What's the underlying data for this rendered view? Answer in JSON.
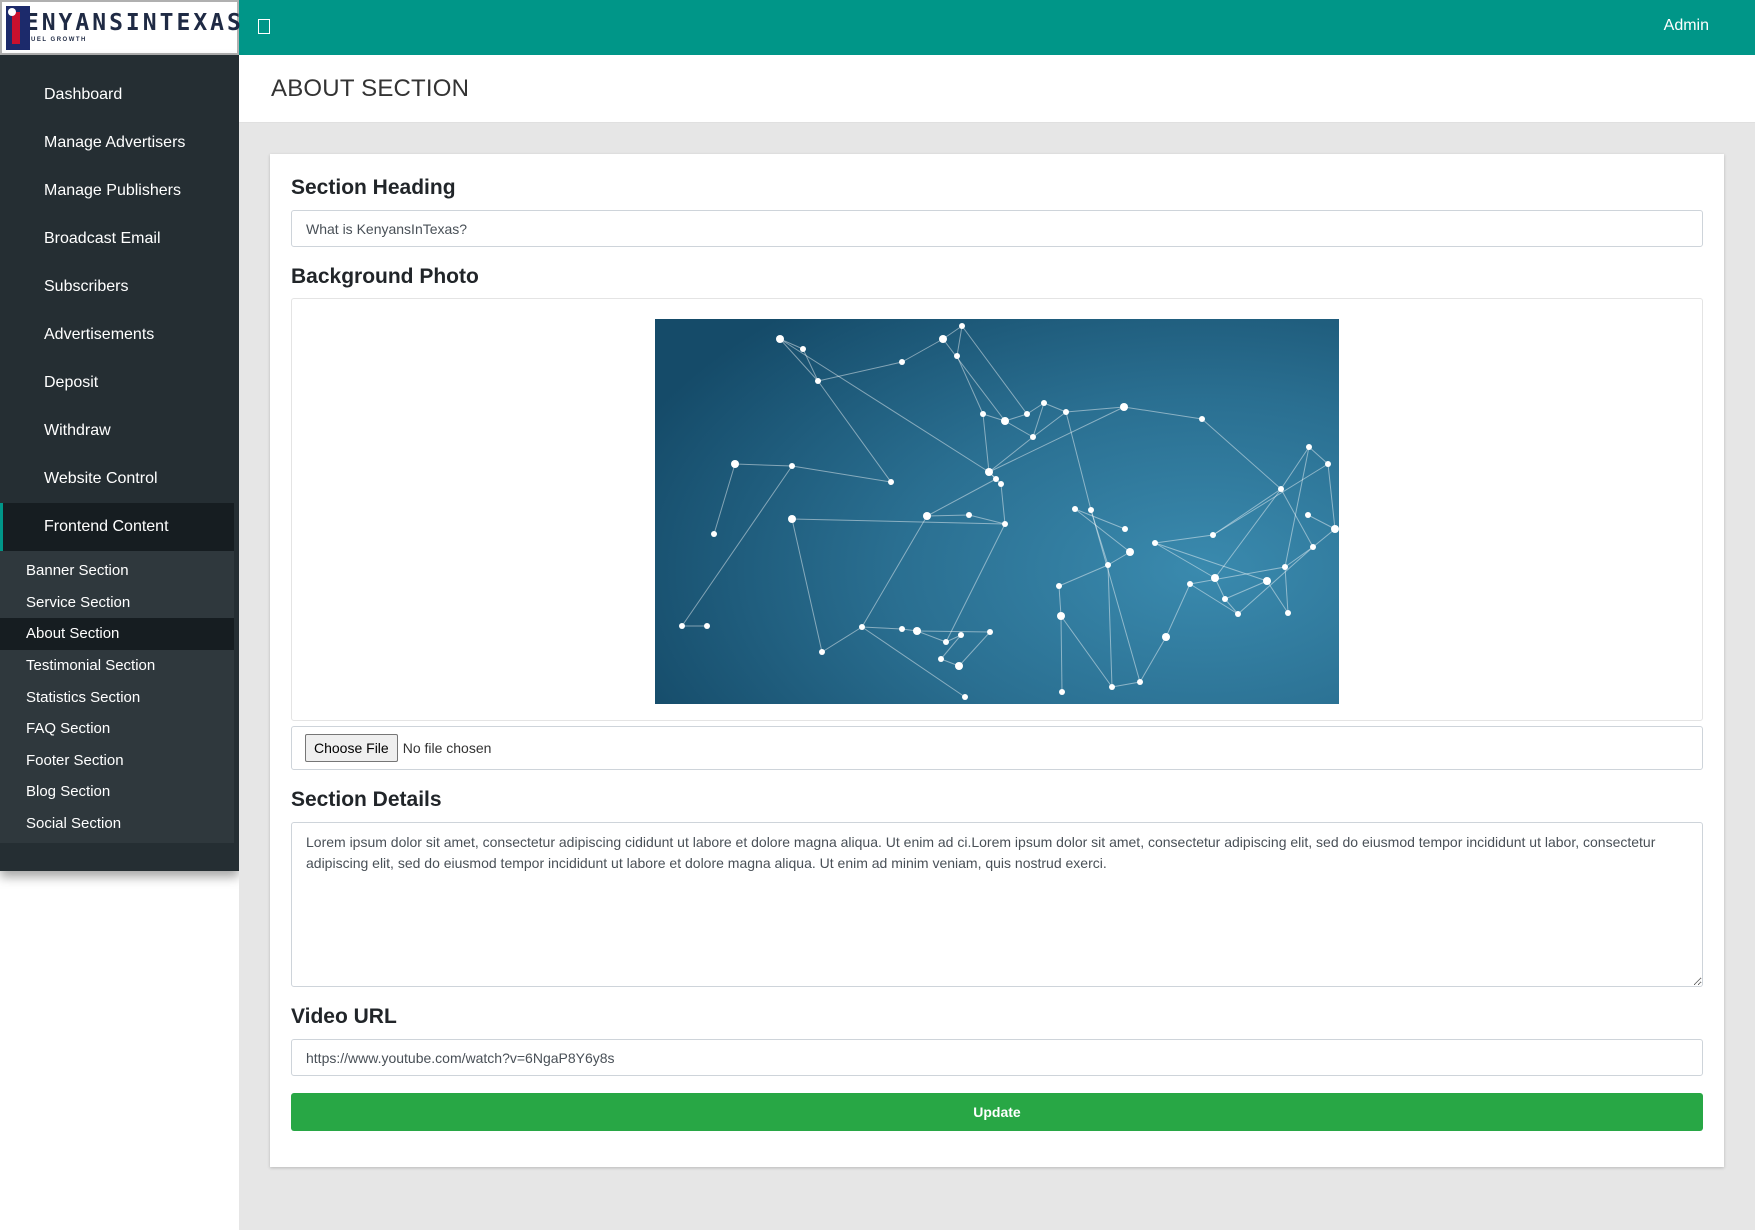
{
  "brand": {
    "name": "KENYANSINTEXAS",
    "tagline": "WE FUEL GROWTH"
  },
  "header": {
    "user_label": "Admin",
    "accent_color": "#009688"
  },
  "sidebar": {
    "items": [
      {
        "label": "Dashboard"
      },
      {
        "label": "Manage Advertisers"
      },
      {
        "label": "Manage Publishers"
      },
      {
        "label": "Broadcast Email"
      },
      {
        "label": "Subscribers"
      },
      {
        "label": "Advertisements"
      },
      {
        "label": "Deposit"
      },
      {
        "label": "Withdraw"
      },
      {
        "label": "Website Control"
      },
      {
        "label": "Frontend Content"
      }
    ],
    "subitems": [
      {
        "label": "Banner Section"
      },
      {
        "label": "Service Section"
      },
      {
        "label": "About Section"
      },
      {
        "label": "Testimonial Section"
      },
      {
        "label": "Statistics Section"
      },
      {
        "label": "FAQ Section"
      },
      {
        "label": "Footer Section"
      },
      {
        "label": "Blog Section"
      },
      {
        "label": "Social Section"
      }
    ]
  },
  "page": {
    "title": "ABOUT SECTION"
  },
  "form": {
    "heading_label": "Section Heading",
    "heading_value": "What is KenyansInTexas?",
    "photo_label": "Background Photo",
    "file_button": "Choose File",
    "file_status": "No file chosen",
    "details_label": "Section Details",
    "details_value": "Lorem ipsum dolor sit amet, consectetur adipiscing cididunt ut labore et dolore magna aliqua. Ut enim ad ci.Lorem ipsum dolor sit amet, consectetur adipiscing elit, sed do eiusmod tempor incididunt ut labor, consectetur adipiscing elit, sed do eiusmod tempor incididunt ut labore et dolore magna aliqua. Ut enim ad minim veniam, quis nostrud exerci.",
    "video_label": "Video URL",
    "video_value": "https://www.youtube.com/watch?v=6NgaP8Y6y8s",
    "submit_label": "Update",
    "submit_color": "#28a745"
  }
}
